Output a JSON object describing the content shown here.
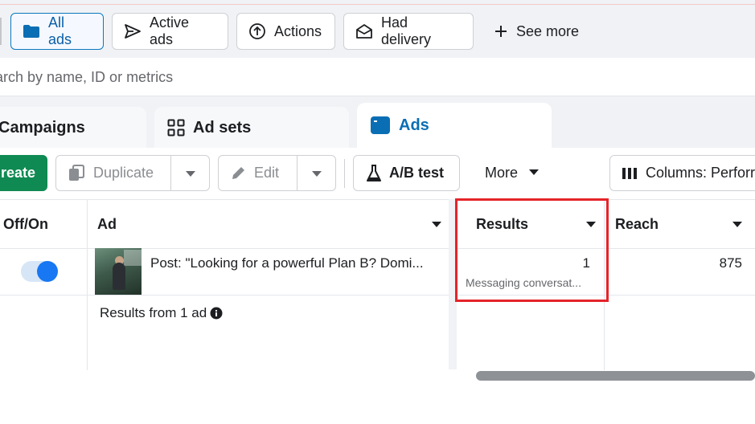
{
  "filters": {
    "all_ads": "All ads",
    "active_ads": "Active ads",
    "actions": "Actions",
    "had_delivery": "Had delivery",
    "see_more": "See more"
  },
  "search": {
    "placeholder": "arch by name, ID or metrics"
  },
  "tabs": {
    "campaigns": "Campaigns",
    "ad_sets": "Ad sets",
    "ads": "Ads"
  },
  "toolbar": {
    "create": "reate",
    "duplicate": "Duplicate",
    "edit": "Edit",
    "ab_test": "A/B test",
    "more": "More",
    "columns": "Columns: Perforr"
  },
  "table": {
    "headers": {
      "off_on": "Off/On",
      "ad": "Ad",
      "results": "Results",
      "reach": "Reach"
    },
    "rows": [
      {
        "ad_name": "Post: \"Looking for a powerful Plan B? Domi...",
        "results": "1",
        "results_sub": "Messaging conversat...",
        "reach": "875",
        "on": true
      }
    ],
    "summary": "Results from 1 ad"
  },
  "colors": {
    "accent": "#0a6eb4",
    "create": "#0f8a52",
    "toggle": "#1877f2",
    "highlight": "#e5242a"
  }
}
